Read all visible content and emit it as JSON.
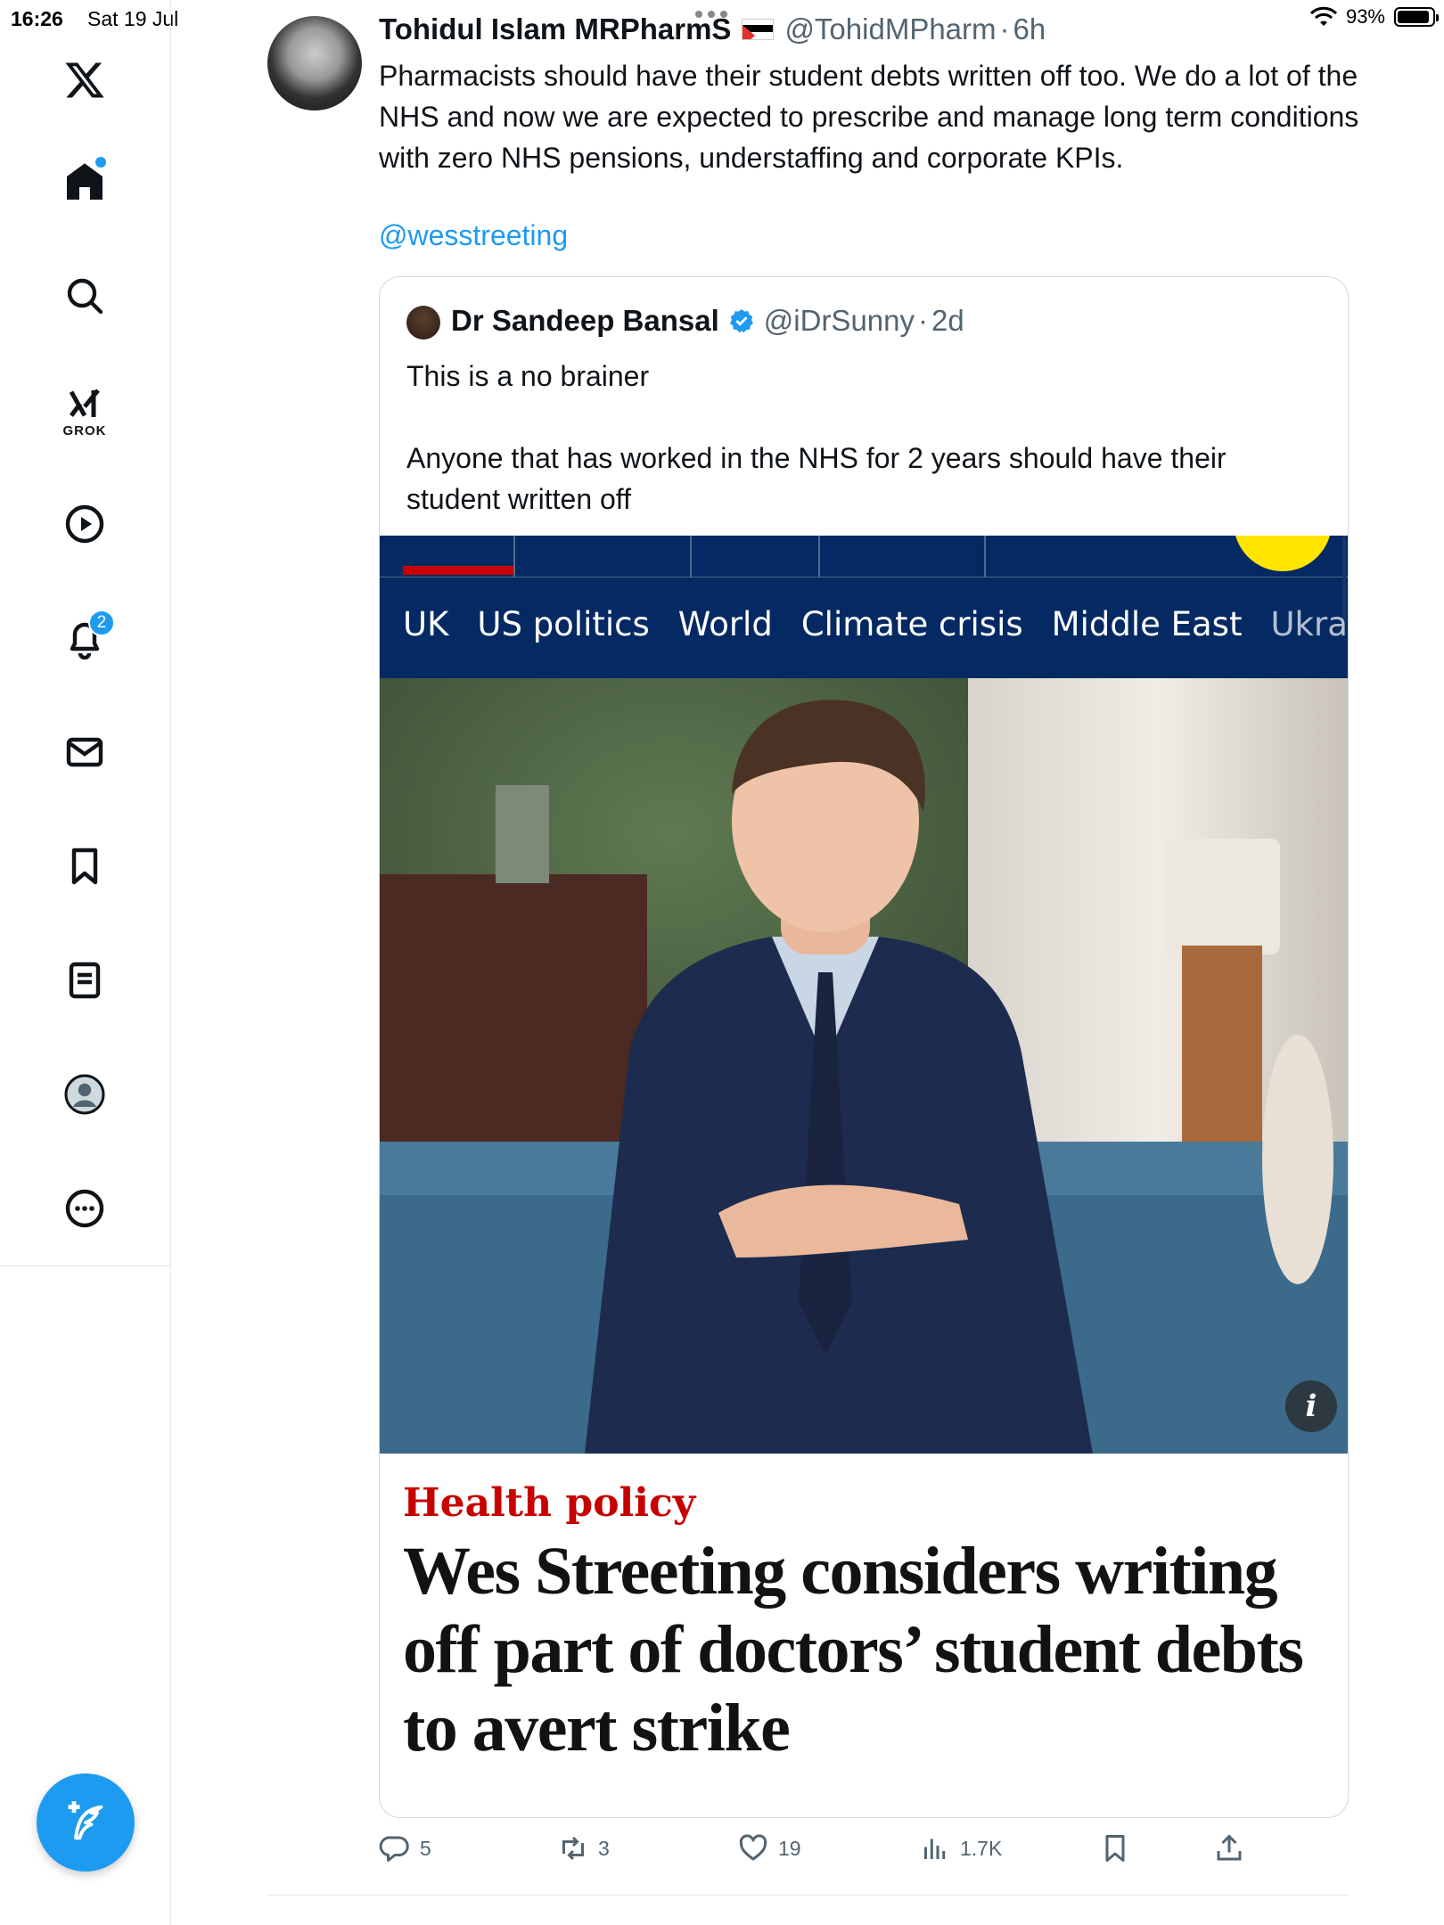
{
  "status_bar": {
    "time": "16:26",
    "date": "Sat 19 Jul",
    "battery_text": "93%",
    "battery_level": 0.93
  },
  "sidebar": {
    "grok_label": "GROK",
    "notifications_badge": "2",
    "items": [
      "x-logo",
      "home",
      "search",
      "grok",
      "video",
      "notifications",
      "messages",
      "bookmarks",
      "lists",
      "profile",
      "more"
    ]
  },
  "tweet": {
    "author_name": "Tohidul Islam MRPharmS",
    "author_handle": "@TohidMPharm",
    "time_ago": "6h",
    "text": "Pharmacists should have their student debts written off too. We do a lot of the NHS and now we are expected to prescribe and manage long term conditions with zero NHS pensions, understaffing and corporate KPIs.",
    "mention": "@wesstreeting",
    "stats": {
      "replies": "5",
      "reposts": "3",
      "likes": "19",
      "views": "1.7K"
    }
  },
  "quote": {
    "author_name": "Dr Sandeep Bansal",
    "author_handle": "@iDrSunny",
    "time_ago": "2d",
    "text_line1": "This is a no brainer",
    "text_line2": "Anyone that has worked in the NHS for 2 years should have their student written off",
    "article": {
      "nav_items": [
        "UK",
        "US politics",
        "World",
        "Climate crisis",
        "Middle East",
        "Ukraine"
      ],
      "kicker": "Health policy",
      "headline": "Wes Streeting considers writing off part of doctors’ student debts to avert strike",
      "info_symbol": "i"
    }
  },
  "colors": {
    "accent": "#1d9bf0",
    "guardian_blue": "#052962",
    "guardian_red": "#c70000",
    "guardian_yellow": "#ffe500",
    "muted_text": "#536471"
  }
}
